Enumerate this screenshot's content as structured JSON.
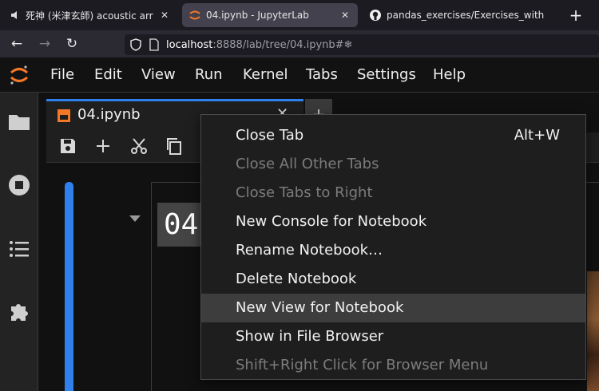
{
  "browser": {
    "tabs": [
      {
        "title": "死神 (米津玄師) acoustic arrang",
        "icon": "speaker-icon"
      },
      {
        "title": "04.ipynb - JupyterLab",
        "icon": "jupyter-logo-icon",
        "active": true
      },
      {
        "title": "pandas_exercises/Exercises_with",
        "icon": "github-icon"
      }
    ],
    "url_host": "localhost",
    "url_path": ":8888/lab/tree/04.ipynb#❄"
  },
  "jupyter": {
    "menus": [
      "File",
      "Edit",
      "View",
      "Run",
      "Kernel",
      "Tabs",
      "Settings",
      "Help"
    ],
    "doc_tab": {
      "title": "04.ipynb"
    },
    "cell_heading_fragment": "04"
  },
  "context_menu": {
    "items": [
      {
        "label": "Close Tab",
        "shortcut": "Alt+W",
        "disabled": false,
        "highlighted": false
      },
      {
        "label": "Close All Other Tabs",
        "shortcut": "",
        "disabled": true,
        "highlighted": false
      },
      {
        "label": "Close Tabs to Right",
        "shortcut": "",
        "disabled": true,
        "highlighted": false
      },
      {
        "label": "New Console for Notebook",
        "shortcut": "",
        "disabled": false,
        "highlighted": false
      },
      {
        "label": "Rename Notebook…",
        "shortcut": "",
        "disabled": false,
        "highlighted": false
      },
      {
        "label": "Delete Notebook",
        "shortcut": "",
        "disabled": false,
        "highlighted": false
      },
      {
        "label": "New View for Notebook",
        "shortcut": "",
        "disabled": false,
        "highlighted": true
      },
      {
        "label": "Show in File Browser",
        "shortcut": "",
        "disabled": false,
        "highlighted": false
      },
      {
        "label": "Shift+Right Click for Browser Menu",
        "shortcut": "",
        "disabled": true,
        "highlighted": false
      }
    ]
  },
  "colors": {
    "accent": "#2f80ed",
    "jupyter_orange": "#f37726",
    "menu_highlight": "#3d3d3d"
  }
}
